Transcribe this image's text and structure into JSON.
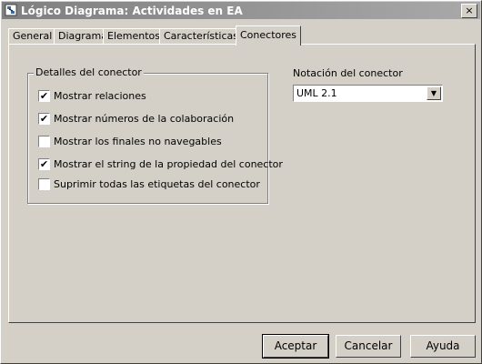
{
  "window": {
    "title": "Lógico Diagrama: Actividades en EA",
    "close_label": "×"
  },
  "tabs": [
    {
      "label": "General"
    },
    {
      "label": "Diagrama"
    },
    {
      "label": "Elementos"
    },
    {
      "label": "Características"
    },
    {
      "label": "Conectores",
      "active": true
    }
  ],
  "connector_details": {
    "title": "Detalles del conector",
    "options": [
      {
        "label": "Mostrar relaciones",
        "checked": true
      },
      {
        "label": "Mostrar números de la colaboración",
        "checked": true
      },
      {
        "label": "Mostrar los finales no navegables",
        "checked": false
      },
      {
        "label": "Mostrar el string de la propiedad del conector",
        "checked": true
      },
      {
        "label": "Suprimir todas las etiquetas del conector",
        "checked": false
      }
    ]
  },
  "notation": {
    "label": "Notación del conector",
    "value": "UML 2.1"
  },
  "buttons": {
    "ok": "Aceptar",
    "cancel": "Cancelar",
    "help": "Ayuda"
  }
}
